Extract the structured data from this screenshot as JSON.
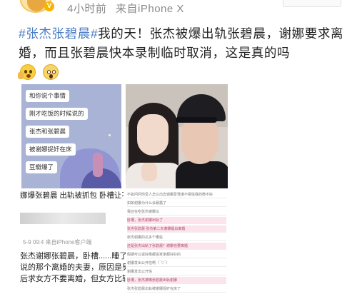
{
  "header": {
    "time_ago": "4小时前",
    "source": "来自iPhone X",
    "verified_badge": "V"
  },
  "post": {
    "hashtag": "#张杰张碧晨#",
    "body": "我的天！张杰被爆出轨张碧晨，谢娜要求离婚，而且张碧晨快本录制临时取消，这是真的吗",
    "emojis": [
      "thinking-emoji-icon",
      "shocked-emoji-icon"
    ]
  },
  "chat_image": {
    "bubbles": [
      "和你说个事情",
      "刚才吃饭的时候说的",
      "张杰和张碧晨",
      "被谢娜捉奸在床",
      "豆瓣爆了"
    ]
  },
  "caption_left": "娜爆张碧晨 出轨被抓包 卧槽让不让",
  "news_image": {
    "meta": "5-9 09:4  来自iPhone客户端",
    "lines": [
      "张杰谢娜张碧晨，卧槽......睡了先",
      "说的那个离婚的夫妻，原因是男方",
      "后求女方不要离婚，但女方比较"
    ]
  },
  "list_image": {
    "items": [
      "不如问问你爱人怎么出去谢娜爱怪谁不相信我的微不好",
      "如如谢娜为什么会暴露了",
      "我还在吃张杰谢娜瓜",
      "卧槽，张杰谢娜出轨了",
      "张杰张碧晨 张杰第二天谢娜提出离婚",
      "张杰谢娜的瓜多个哪些",
      "还是张杰出轨了张碧晨？谢娜也要离婚",
      "假期可以说好像都说家家都好好的",
      "谢娜发出公开信啊（¯▽¯）",
      "谢娜发出公开信",
      "卧槽，张杰被曝张碧晨出轨谢娜",
      "张杰张碧晨出轨被谢娜捉奸在床了"
    ]
  }
}
